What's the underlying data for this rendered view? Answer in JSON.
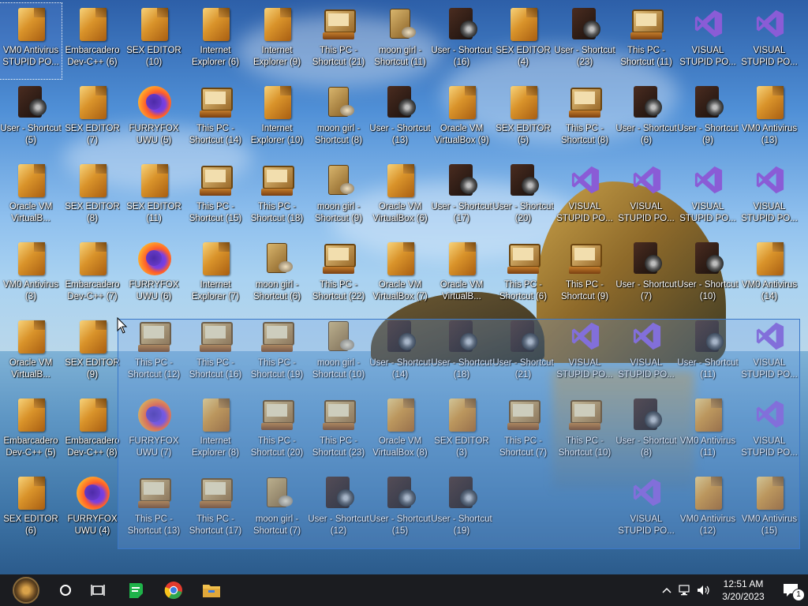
{
  "desktop": {
    "icons": [
      {
        "label": "VM0 Antivirus STUPID PO...",
        "type": "folder",
        "selected": true
      },
      {
        "label": "Embarcadero Dev-C++ (6)",
        "type": "folder"
      },
      {
        "label": "SEX EDITOR (10)",
        "type": "folder"
      },
      {
        "label": "Internet Explorer (6)",
        "type": "folder"
      },
      {
        "label": "Internet Explorer (9)",
        "type": "folder"
      },
      {
        "label": "This PC - Shortcut (21)",
        "type": "pc"
      },
      {
        "label": "moon girl - Shortcut (11)",
        "type": "bag"
      },
      {
        "label": "User - Shortcut (16)",
        "type": "user"
      },
      {
        "label": "SEX EDITOR (4)",
        "type": "folder"
      },
      {
        "label": "User - Shortcut (23)",
        "type": "user"
      },
      {
        "label": "This PC - Shortcut (11)",
        "type": "pc"
      },
      {
        "label": "VISUAL STUPID PO...",
        "type": "vs"
      },
      {
        "label": "VISUAL STUPID PO...",
        "type": "vs"
      },
      {
        "label": "User - Shortcut (5)",
        "type": "user"
      },
      {
        "label": "SEX EDITOR (7)",
        "type": "folder"
      },
      {
        "label": "FURRYFOX UWU (5)",
        "type": "ff"
      },
      {
        "label": "This PC - Shortcut (14)",
        "type": "pc"
      },
      {
        "label": "Internet Explorer (10)",
        "type": "folder"
      },
      {
        "label": "moon girl - Shortcut (8)",
        "type": "bag"
      },
      {
        "label": "User - Shortcut (13)",
        "type": "user"
      },
      {
        "label": "Oracle VM VirtualBox (9)",
        "type": "folder"
      },
      {
        "label": "SEX EDITOR (5)",
        "type": "folder"
      },
      {
        "label": "This PC - Shortcut (8)",
        "type": "pc"
      },
      {
        "label": "User - Shortcut (6)",
        "type": "user"
      },
      {
        "label": "User - Shortcut (9)",
        "type": "user"
      },
      {
        "label": "VM0 Antivirus (13)",
        "type": "folder"
      },
      {
        "label": "Oracle VM VirtualB...",
        "type": "folder"
      },
      {
        "label": "SEX EDITOR (8)",
        "type": "folder"
      },
      {
        "label": "SEX EDITOR (11)",
        "type": "folder"
      },
      {
        "label": "This PC - Shortcut (15)",
        "type": "pc"
      },
      {
        "label": "This PC - Shortcut (18)",
        "type": "pc"
      },
      {
        "label": "moon girl - Shortcut (9)",
        "type": "bag"
      },
      {
        "label": "Oracle VM VirtualBox (6)",
        "type": "folder"
      },
      {
        "label": "User - Shortcut (17)",
        "type": "user"
      },
      {
        "label": "User - Shortcut (20)",
        "type": "user"
      },
      {
        "label": "VISUAL STUPID PO...",
        "type": "vs"
      },
      {
        "label": "VISUAL STUPID PO...",
        "type": "vs"
      },
      {
        "label": "VISUAL STUPID PO...",
        "type": "vs"
      },
      {
        "label": "VISUAL STUPID PO...",
        "type": "vs"
      },
      {
        "label": "VM0 Antivirus (3)",
        "type": "folder"
      },
      {
        "label": "Embarcadero Dev-C++ (7)",
        "type": "folder"
      },
      {
        "label": "FURRYFOX UWU (6)",
        "type": "ff"
      },
      {
        "label": "Internet Explorer (7)",
        "type": "folder"
      },
      {
        "label": "moon girl - Shortcut (6)",
        "type": "bag"
      },
      {
        "label": "This PC - Shortcut (22)",
        "type": "pc"
      },
      {
        "label": "Oracle VM VirtualBox (7)",
        "type": "folder"
      },
      {
        "label": "Oracle VM VirtualB...",
        "type": "folder"
      },
      {
        "label": "This PC - Shortcut (6)",
        "type": "pc"
      },
      {
        "label": "This PC - Shortcut (9)",
        "type": "pc"
      },
      {
        "label": "User - Shortcut (7)",
        "type": "user"
      },
      {
        "label": "User - Shortcut (10)",
        "type": "user"
      },
      {
        "label": "VM0 Antivirus (14)",
        "type": "folder"
      },
      {
        "label": "Oracle VM VirtualB...",
        "type": "folder"
      },
      {
        "label": "SEX EDITOR (9)",
        "type": "folder"
      },
      {
        "label": "This PC - Shortcut (12)",
        "type": "pc"
      },
      {
        "label": "This PC - Shortcut (16)",
        "type": "pc"
      },
      {
        "label": "This PC - Shortcut (19)",
        "type": "pc"
      },
      {
        "label": "moon girl - Shortcut (10)",
        "type": "bag"
      },
      {
        "label": "User - Shortcut (14)",
        "type": "user"
      },
      {
        "label": "User - Shortcut (18)",
        "type": "user"
      },
      {
        "label": "User - Shortcut (21)",
        "type": "user"
      },
      {
        "label": "VISUAL STUPID PO...",
        "type": "vs"
      },
      {
        "label": "VISUAL STUPID PO...",
        "type": "vs"
      },
      {
        "label": "User - Shortcut (11)",
        "type": "user"
      },
      {
        "label": "VISUAL STUPID PO...",
        "type": "vs"
      },
      {
        "label": "Embarcadero Dev-C++ (5)",
        "type": "folder"
      },
      {
        "label": "Embarcadero Dev-C++ (8)",
        "type": "folder"
      },
      {
        "label": "FURRYFOX UWU (7)",
        "type": "ff"
      },
      {
        "label": "Internet Explorer (8)",
        "type": "folder"
      },
      {
        "label": "This PC - Shortcut (20)",
        "type": "pc"
      },
      {
        "label": "This PC - Shortcut (23)",
        "type": "pc"
      },
      {
        "label": "Oracle VM VirtualBox (8)",
        "type": "folder"
      },
      {
        "label": "SEX EDITOR (3)",
        "type": "folder"
      },
      {
        "label": "This PC - Shortcut (7)",
        "type": "pc"
      },
      {
        "label": "This PC - Shortcut (10)",
        "type": "pc"
      },
      {
        "label": "User - Shortcut (8)",
        "type": "user"
      },
      {
        "label": "VM0 Antivirus (11)",
        "type": "folder"
      },
      {
        "label": "VISUAL STUPID PO...",
        "type": "vs"
      },
      {
        "label": "SEX EDITOR (6)",
        "type": "folder"
      },
      {
        "label": "FURRYFOX UWU (4)",
        "type": "ff"
      },
      {
        "label": "This PC - Shortcut (13)",
        "type": "pc"
      },
      {
        "label": "This PC - Shortcut (17)",
        "type": "pc"
      },
      {
        "label": "moon girl - Shortcut (7)",
        "type": "bag"
      },
      {
        "label": "User - Shortcut (12)",
        "type": "user"
      },
      {
        "label": "User - Shortcut (15)",
        "type": "user"
      },
      {
        "label": "User - Shortcut (19)",
        "type": "user"
      },
      {
        "label": "",
        "type": "none"
      },
      {
        "label": "",
        "type": "none"
      },
      {
        "label": "VISUAL STUPID PO...",
        "type": "vs"
      },
      {
        "label": "VM0 Antivirus (12)",
        "type": "folder"
      },
      {
        "label": "VM0 Antivirus (15)",
        "type": "folder"
      }
    ]
  },
  "taskbar": {
    "start_icon": "start-logo-icon",
    "search_icon": "cortana-circle-icon",
    "taskview_icon": "task-view-icon",
    "pinned": [
      {
        "name": "notes-app-icon",
        "color": "#1fb34a"
      },
      {
        "name": "chrome-icon",
        "color": "#e33b2e"
      },
      {
        "name": "file-explorer-icon",
        "color": "#f2c14e"
      }
    ],
    "tray": {
      "chevron_icon": "chevron-up-icon",
      "network_icon": "network-icon",
      "volume_icon": "volume-icon",
      "time": "12:51 AM",
      "date": "3/20/2023",
      "notification_count": "1"
    }
  },
  "colors": {
    "taskbar": "#1b1c20",
    "selection": "#3b78c8",
    "vs_purple": "#8a5cd6"
  }
}
